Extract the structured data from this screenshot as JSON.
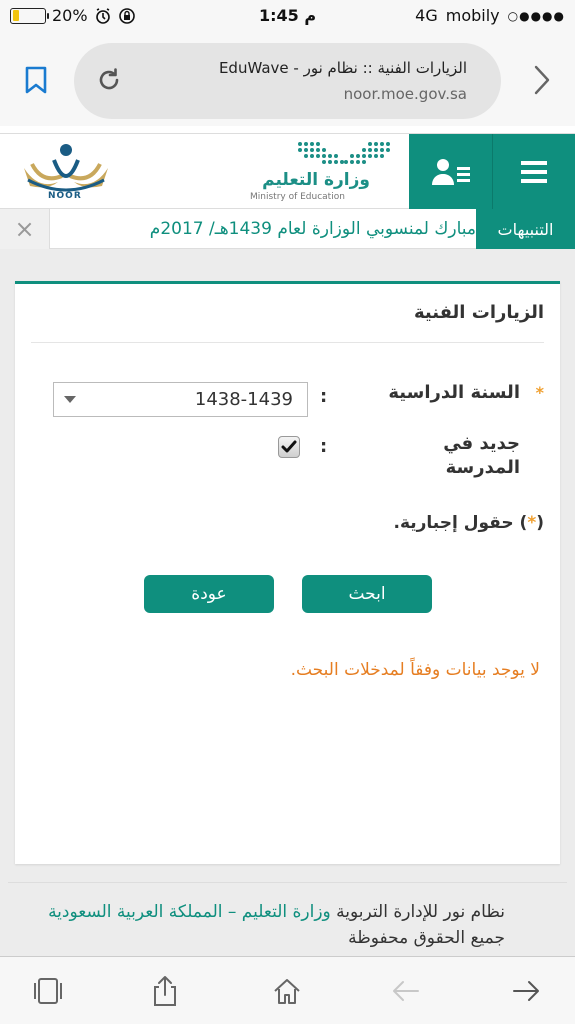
{
  "status": {
    "battery_percent": "20%",
    "battery_level": 0.2,
    "time": "1:45 م",
    "network": "4G",
    "carrier": "mobily",
    "signal_dots": "○●●●●"
  },
  "browser": {
    "page_title": "الزيارات الفنية :: نظام نور - EduWave",
    "url": "noor.moe.gov.sa"
  },
  "header": {
    "noor_logo_text": "NOOR",
    "moe_arabic": "وزارة التعليم",
    "moe_english": "Ministry of Education"
  },
  "notification": {
    "label": "التنبيهات",
    "text": "مبارك لمنسوبي الوزارة لعام 1439هـ/ 2017م",
    "close": "×"
  },
  "card": {
    "title": "الزيارات الفنية",
    "year_label": "السنة الدراسية",
    "year_value": "1438-1439",
    "new_label_line1": "جديد في",
    "new_label_line2": "المدرسة",
    "required_star": "*",
    "colon": ":",
    "mandatory_prefix": "(",
    "mandatory_star": "*",
    "mandatory_suffix": ") حقول إجبارية.",
    "search_button": "ابحث",
    "back_button": "عودة",
    "no_data_message": "لا يوجد بيانات وفقاً لمدخلات البحث."
  },
  "footer": {
    "text_before": "نظام نور للإدارة التربوية ",
    "link_ministry": "وزارة التعليم – المملكة العربية السعودية",
    "text_after": " جميع الحقوق محفوظة"
  },
  "colors": {
    "brand": "#0f8f7e",
    "warning": "#e67e22",
    "required": "#f0a030"
  }
}
